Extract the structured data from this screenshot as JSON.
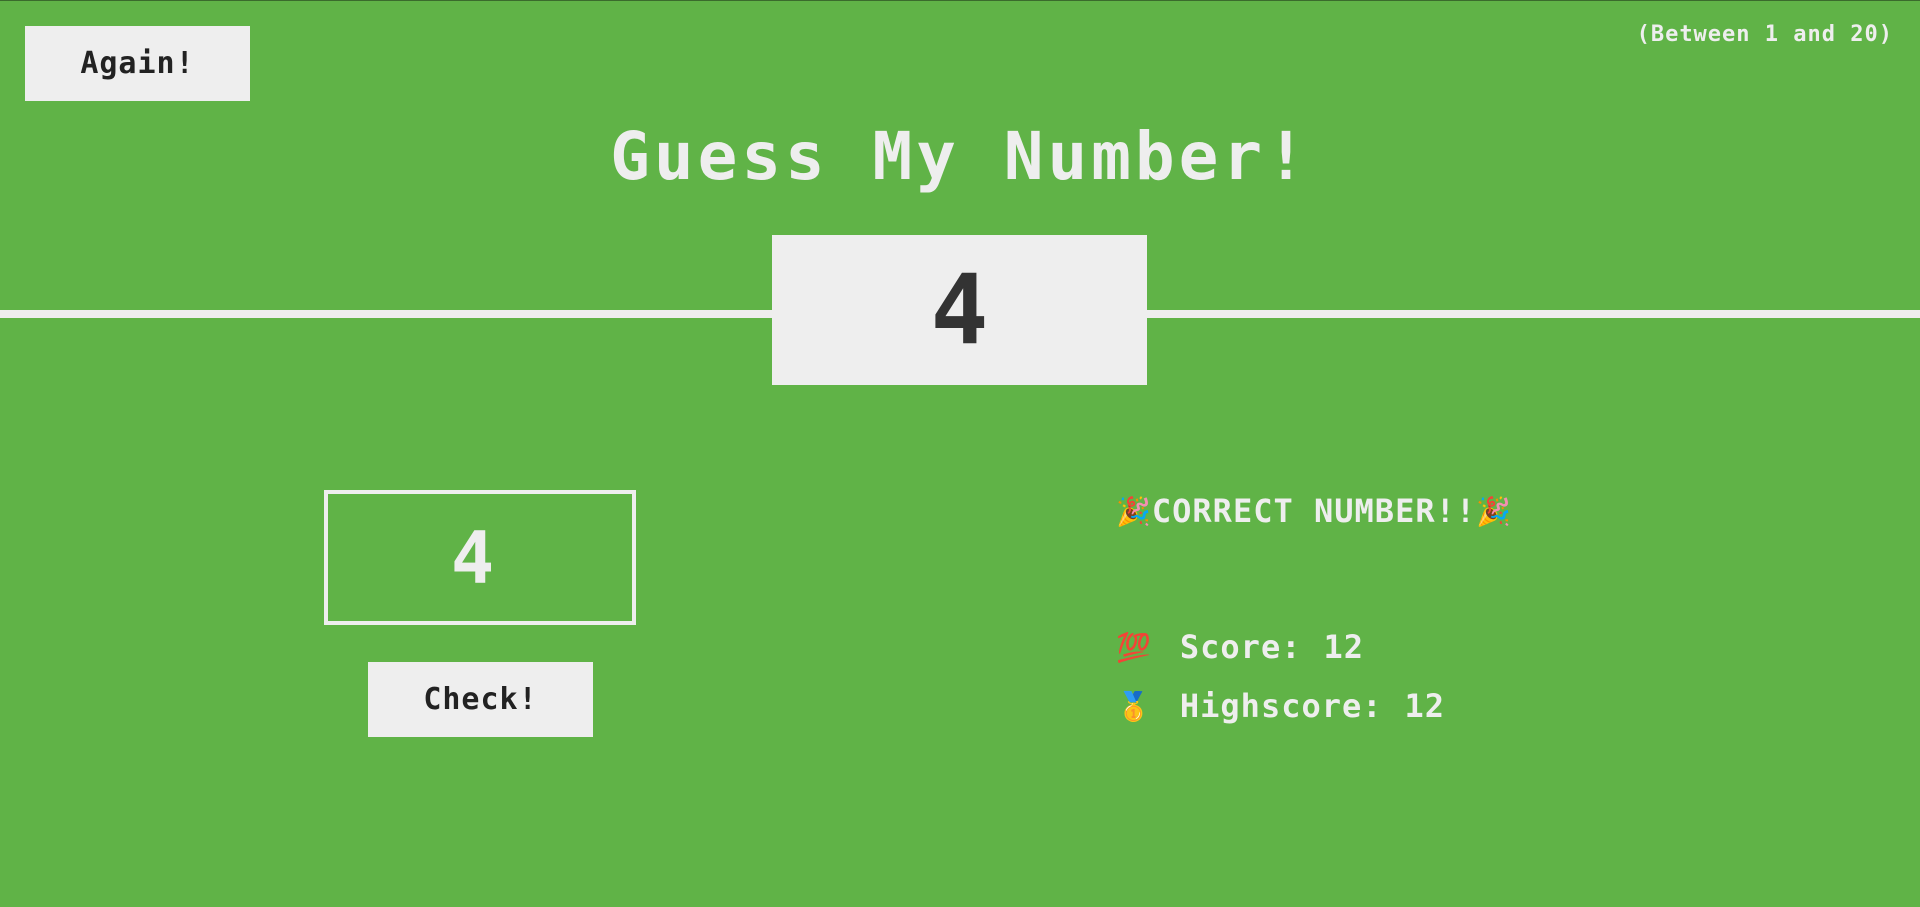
{
  "header": {
    "again_label": "Again!",
    "range_hint": "(Between 1 and 20)",
    "title": "Guess My Number!"
  },
  "secret": {
    "number": "4"
  },
  "guess": {
    "value": "4"
  },
  "controls": {
    "check_label": "Check!"
  },
  "status": {
    "emoji_left": "🎉",
    "message": "CORRECT NUMBER!!",
    "emoji_right": "🎉"
  },
  "stats": {
    "score_emoji": "💯",
    "score_label": "Score:",
    "score_value": "12",
    "highscore_emoji": "🥇",
    "highscore_label": "Highscore:",
    "highscore_value": "12"
  },
  "colors": {
    "background": "#60b347",
    "foreground": "#eeeeee",
    "dark_text": "#333333"
  }
}
